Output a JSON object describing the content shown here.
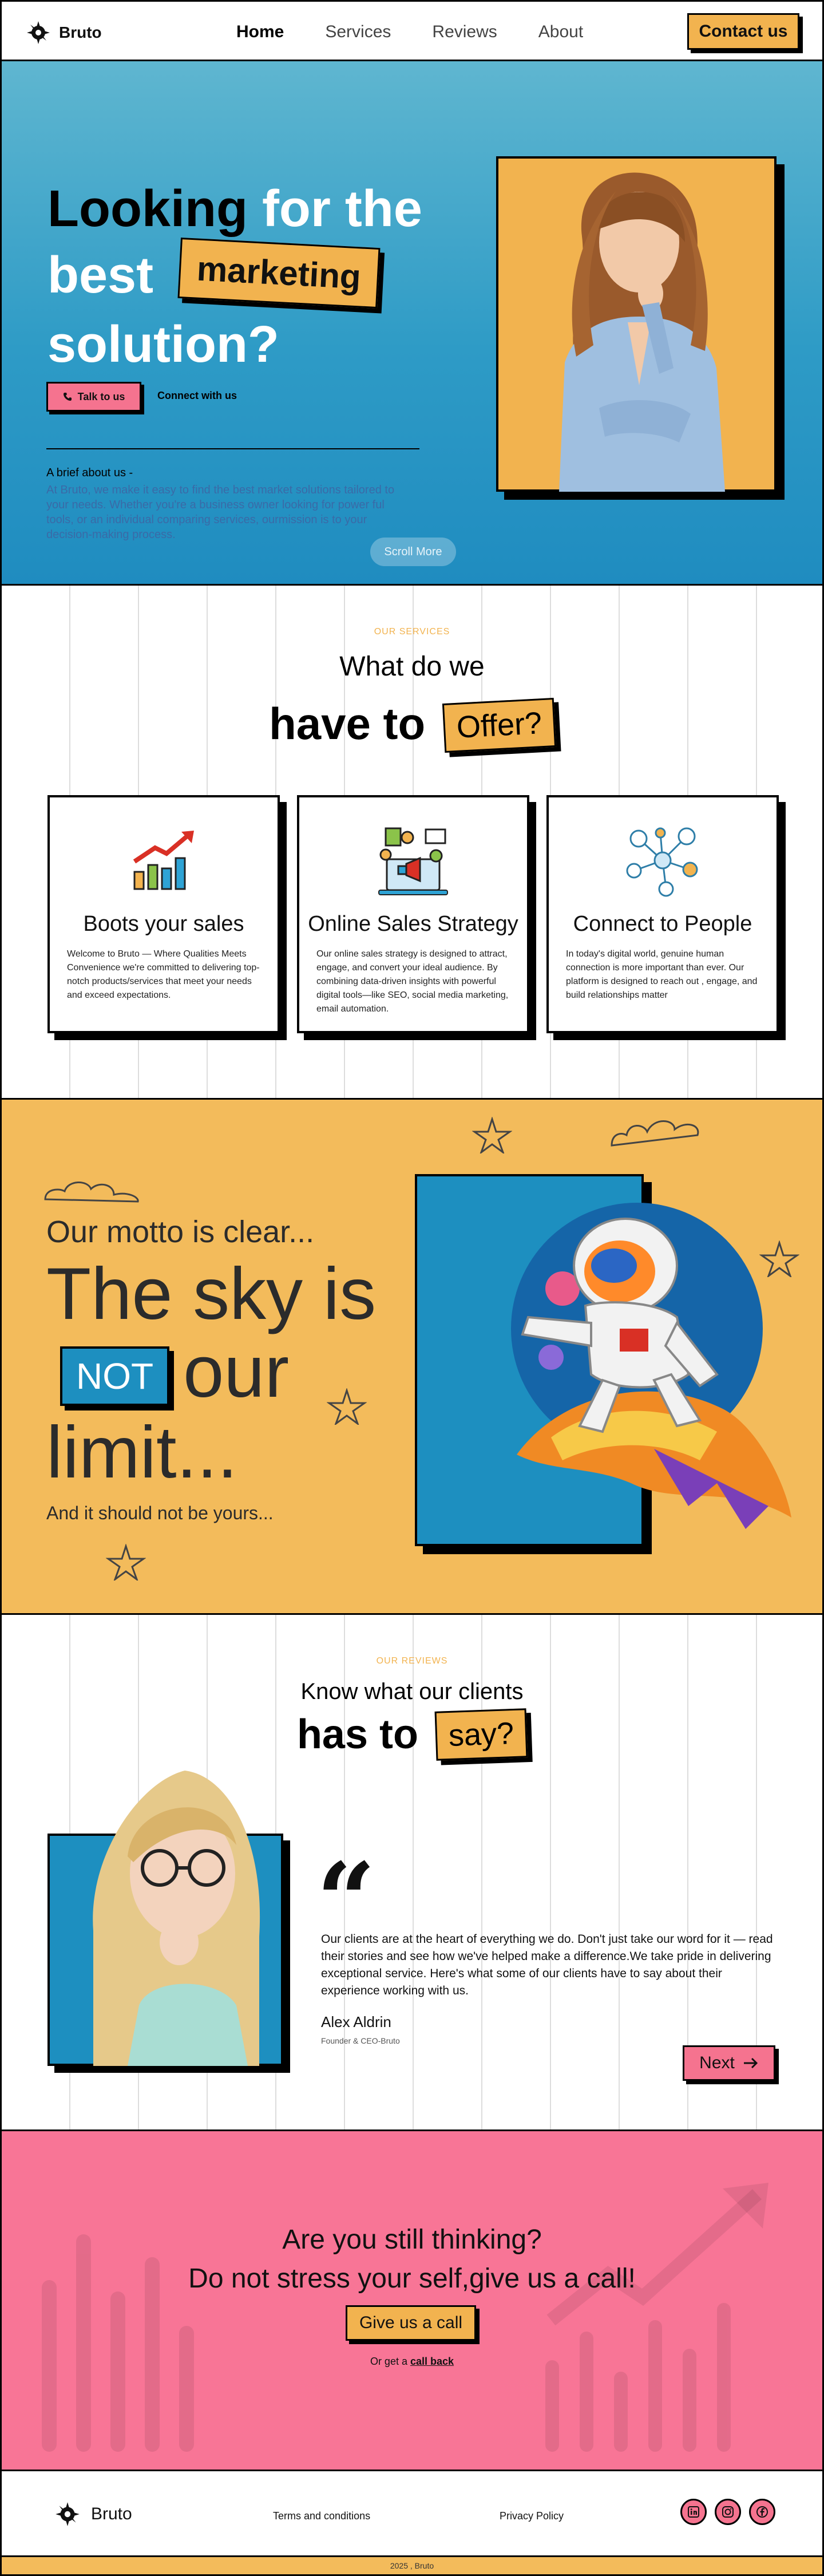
{
  "header": {
    "logo_text": "Bruto",
    "nav": [
      {
        "label": "Home",
        "active": true
      },
      {
        "label": "Services",
        "active": false
      },
      {
        "label": "Reviews",
        "active": false
      },
      {
        "label": "About",
        "active": false
      }
    ],
    "contact_label": "Contact us"
  },
  "hero": {
    "title_dark": "Looking",
    "title_line1_rest": "for the",
    "title_line2": "best",
    "title_tag": "marketing",
    "title_line3": "solution?",
    "talk_label": "Talk to us",
    "connect_label": "Connect with us",
    "brief_title": "A brief about us -",
    "brief_text": "At Bruto, we make it easy to find the best market solutions tailored to your needs. Whether you're a business owner looking for power ful tools, or an individual comparing services, ourmission is to your decision-making process.",
    "scroll_label": "Scroll More"
  },
  "services": {
    "eyebrow": "OUR SERVICES",
    "title_line1": "What do we",
    "title_line2": "have to",
    "title_tag": "Offer?",
    "cards": [
      {
        "title": "Boots your sales",
        "text": "Welcome to Bruto — Where Qualities Meets Convenience we're committed to delivering top-notch products/services that meet your needs and exceed expectations.",
        "icon": "sales-chart-icon"
      },
      {
        "title": "Online Sales Strategy",
        "text": "Our online sales strategy is designed to attract, engage, and convert your ideal audience. By combining data-driven insights with powerful digital tools—like SEO, social media marketing, email automation.",
        "icon": "online-marketing-icon"
      },
      {
        "title": "Connect to People",
        "text": "In today's digital world, genuine human connection is more important than ever. Our platform is designed to reach out , engage, and build relationships matter",
        "icon": "network-people-icon"
      }
    ]
  },
  "motto": {
    "line1": "Our motto is clear...",
    "big1": "The sky is",
    "not_tag": "NOT",
    "big2": "our",
    "big3": "limit...",
    "sub": "And it should not be yours..."
  },
  "reviews": {
    "eyebrow": "OUR REVIEWS",
    "title_line1": "Know what our clients",
    "title_line2": "has to",
    "title_tag": "say?",
    "quote_mark": "“",
    "text": "Our clients are at the heart of everything we do. Don't just take our word for it — read their stories and see how we've helped make a difference.We take pride in delivering exceptional service. Here's what some of our clients have to say about their experience working with us.",
    "name": "Alex Aldrin",
    "role": "Founder & CEO-Bruto",
    "next_label": "Next"
  },
  "cta": {
    "line1": "Are you still thinking?",
    "line2": "Do not stress your self,give us a call!",
    "call_label": "Give us a call",
    "or_text": "Or get a",
    "callback_link": "call back"
  },
  "footer": {
    "logo_text": "Bruto",
    "terms": "Terms and conditions",
    "privacy": "Privacy  Policy",
    "socials": [
      "linkedin-icon",
      "instagram-icon",
      "facebook-icon"
    ],
    "copyright": "2025 , Bruto"
  },
  "colors": {
    "hero_blue": "#2e9bc6",
    "accent_yellow": "#f2b34f",
    "accent_pink": "#f5738f",
    "motto_yellow": "#f3bb5b"
  }
}
